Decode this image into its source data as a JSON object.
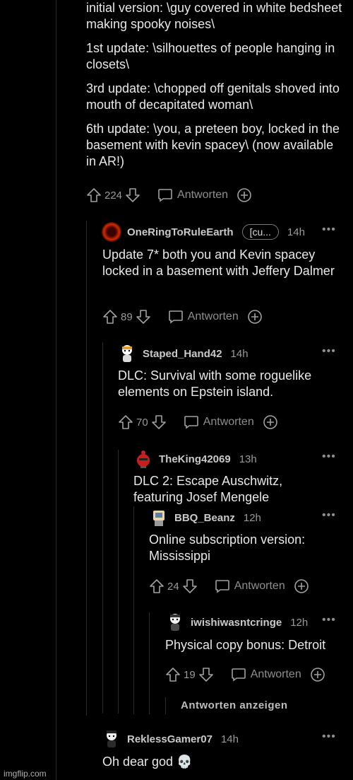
{
  "top_comment": {
    "paragraphs": [
      "initial version: \\guy covered in white bedsheet making spooky noises\\",
      "1st update: \\silhouettes of people hanging in closets\\",
      "3rd update: \\chopped off genitals shoved into mouth of decapitated woman\\",
      "6th update: \\you, a preteen boy, locked in the basement with kevin spacey\\ (now available in AR!)"
    ],
    "votes": "224",
    "reply_label": "Antworten"
  },
  "comments": [
    {
      "user": "OneRingToRuleEarth",
      "flair": "[cu...",
      "time": "14h",
      "body": "Update 7* both you and Kevin spacey locked in a basement with Jeffery Dalmer",
      "votes": "89",
      "reply_label": "Antworten"
    },
    {
      "user": "Staped_Hand42",
      "time": "14h",
      "body": "DLC: Survival with some roguelike elements on Epstein island.",
      "votes": "70",
      "reply_label": "Antworten"
    },
    {
      "user": "TheKing42069",
      "time": "13h",
      "body": "DLC 2: Escape Auschwitz, featuring Josef Mengele"
    },
    {
      "user": "BBQ_Beanz",
      "time": "12h",
      "body": "Online subscription version: Mississippi",
      "votes": "24",
      "reply_label": "Antworten"
    },
    {
      "user": "iwishiwasntcringe",
      "time": "12h",
      "body": "Physical copy bonus: Detroit",
      "votes": "19",
      "reply_label": "Antworten"
    },
    {
      "user": "ReklessGamer07",
      "time": "14h",
      "body": "Oh dear god 💀"
    }
  ],
  "show_replies_label": "Antworten anzeigen",
  "more_icon": "•••",
  "watermark": "imgflip.com",
  "colors": {
    "background": "#000000",
    "text": "#e8e8e8",
    "muted": "#9a9a9a"
  }
}
